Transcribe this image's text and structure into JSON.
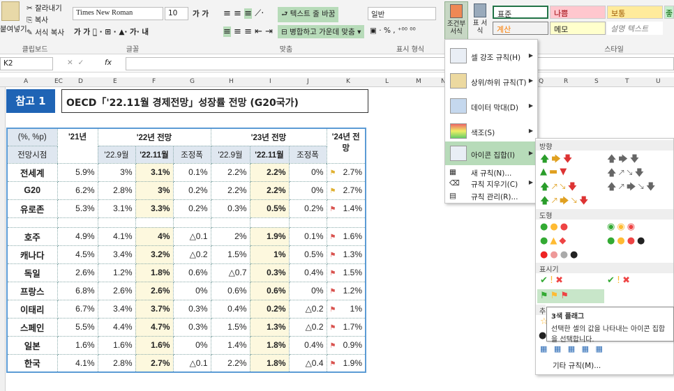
{
  "ribbon": {
    "cut": "잘라내기",
    "copy": "복사",
    "format_painter": "서식 복사",
    "paste": "붙여넣기",
    "font_name": "Times New Roman",
    "font_size": "10",
    "wrap_text": "텍스트 줄 바꿈",
    "merge_center": "병합하고 가운데 맞춤",
    "number_format": "일반",
    "cond_format": "조건부 서식",
    "table_format": "표 서식",
    "clipboard": "클립보드",
    "font": "글꼴",
    "alignment": "맞춤",
    "number": "표시 형식",
    "styles": "스타일",
    "style_normal": "표준",
    "style_bad": "나쁨",
    "style_neutral": "보통",
    "style_good": "좋",
    "style_calc": "계산",
    "style_memo": "메모",
    "style_explain": "설명 텍스트",
    "percent": "%",
    "comma": ","
  },
  "formula_bar": {
    "name_box": "K2",
    "fx": "fx",
    "content": ""
  },
  "columns": [
    "A",
    "EC",
    "D",
    "E",
    "F",
    "G",
    "H",
    "I",
    "J",
    "K",
    "L",
    "M",
    "N",
    "Q",
    "R",
    "S",
    "T",
    "U"
  ],
  "sheet": {
    "tag": "참고 1",
    "title": "OECD「'22.11월 경제전망」성장률 전망 (G20국가)",
    "header1": {
      "unit": "(%, %p)",
      "y21": "'21년",
      "y22": "'22년 전망",
      "y23": "'23년 전망",
      "y24": "'24년 전망"
    },
    "header2": {
      "when": "전망시점",
      "s1": "'22.9월",
      "s2": "'22.11월",
      "s3": "조정폭",
      "s4": "'22.9월",
      "s5": "'22.11월",
      "s6": "조정폭"
    },
    "rows": [
      [
        "전세계",
        "5.9%",
        "3%",
        "3.1%",
        "0.1%",
        "2.2%",
        "2.2%",
        "0%",
        "2.7%",
        "y"
      ],
      [
        "G20",
        "6.2%",
        "2.8%",
        "3%",
        "0.2%",
        "2.2%",
        "2.2%",
        "0%",
        "2.7%",
        "y"
      ],
      [
        "유로존",
        "5.3%",
        "3.1%",
        "3.3%",
        "0.2%",
        "0.3%",
        "0.5%",
        "0.2%",
        "1.4%",
        "r"
      ],
      [
        "호주",
        "4.9%",
        "4.1%",
        "4%",
        "△0.1",
        "2%",
        "1.9%",
        "0.1%",
        "1.6%",
        "r"
      ],
      [
        "캐나다",
        "4.5%",
        "3.4%",
        "3.2%",
        "△0.2",
        "1.5%",
        "1%",
        "0.5%",
        "1.3%",
        "r"
      ],
      [
        "독일",
        "2.6%",
        "1.2%",
        "1.8%",
        "0.6%",
        "△0.7",
        "0.3%",
        "0.4%",
        "1.5%",
        "r"
      ],
      [
        "프랑스",
        "6.8%",
        "2.6%",
        "2.6%",
        "0%",
        "0.6%",
        "0.6%",
        "0%",
        "1.2%",
        "r"
      ],
      [
        "이태리",
        "6.7%",
        "3.4%",
        "3.7%",
        "0.3%",
        "0.4%",
        "0.2%",
        "△0.2",
        "1%",
        "r"
      ],
      [
        "스페인",
        "5.5%",
        "4.4%",
        "4.7%",
        "0.3%",
        "1.5%",
        "1.3%",
        "△0.2",
        "1.7%",
        "r"
      ],
      [
        "일본",
        "1.6%",
        "1.6%",
        "1.6%",
        "0%",
        "1.4%",
        "1.8%",
        "0.4%",
        "0.9%",
        "r"
      ],
      [
        "한국",
        "4.1%",
        "2.8%",
        "2.7%",
        "△0.1",
        "2.2%",
        "1.8%",
        "△0.4",
        "1.9%",
        "r"
      ]
    ]
  },
  "menu": {
    "items": [
      "셀 강조 규칙(H)",
      "상위/하위 규칙(T)",
      "데이터 막대(D)",
      "색조(S)",
      "아이콘 집합(I)",
      "새 규칙(N)...",
      "규칙 지우기(C)",
      "규칙 관리(R)..."
    ]
  },
  "submenu": {
    "direction": "방향",
    "shapes": "도형",
    "indicators": "표시기",
    "ratings": "추",
    "more": "기타 규칙(M)..."
  },
  "tooltip": {
    "title": "3색 플래그",
    "body": "선택한 셀의 값을 나타내는 아이콘 집합을 선택합니다."
  },
  "colors": {
    "accent": "#217346",
    "highlight": "#fdf8de",
    "header": "#dfe7f0"
  }
}
